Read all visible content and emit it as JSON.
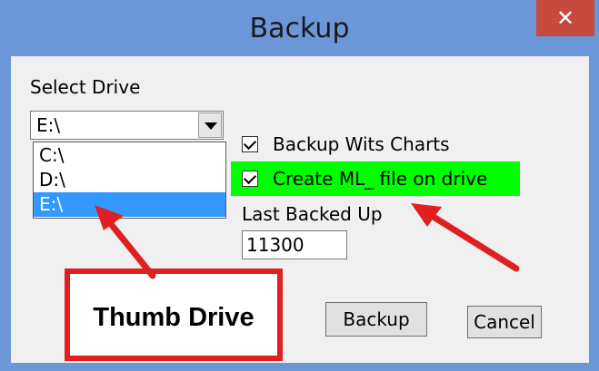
{
  "window": {
    "title": "Backup",
    "close_glyph": "✕"
  },
  "drive": {
    "label": "Select Drive",
    "selected": "E:\\",
    "options": [
      "C:\\",
      "D:\\",
      "E:\\"
    ]
  },
  "options": {
    "backup_wits_charts": {
      "label": "Backup Wits Charts",
      "checked": true
    },
    "create_ml_file": {
      "label": "Create ML_ file on drive",
      "checked": true
    }
  },
  "last_backed_up": {
    "label": "Last Backed Up",
    "value": "11300"
  },
  "buttons": {
    "backup": "Backup",
    "cancel": "Cancel"
  },
  "annotation": {
    "callout_text": "Thumb Drive",
    "highlight_color": "#00ff00",
    "arrow_color": "#e02020"
  }
}
